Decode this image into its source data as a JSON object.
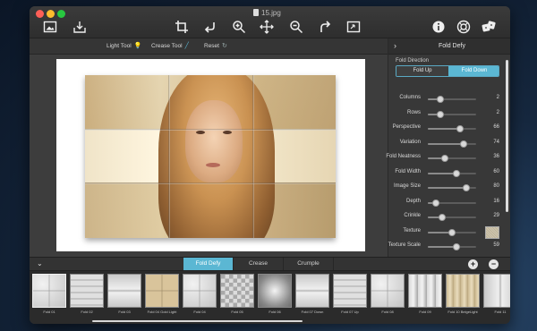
{
  "window": {
    "title": "15.jpg"
  },
  "toolbar": {
    "icons": [
      "image-icon",
      "import-icon",
      "crop-icon",
      "undo-icon",
      "zoom-in-icon",
      "move-icon",
      "zoom-out-icon",
      "redo-icon",
      "fit-screen-icon",
      "info-icon",
      "help-icon",
      "dice-icon"
    ]
  },
  "subbar": {
    "light_tool": "Light Tool",
    "crease_tool": "Crease Tool",
    "reset": "Reset"
  },
  "sidebar": {
    "title": "Fold Defy",
    "fold_direction_label": "Fold Direction",
    "fold_up": "Fold Up",
    "fold_down": "Fold Down",
    "fold_direction_selected": "Fold Down",
    "params": [
      {
        "label": "Columns",
        "value": "2",
        "level": 0.25
      },
      {
        "label": "Rows",
        "value": "2",
        "level": 0.25
      },
      {
        "label": "Perspective",
        "value": "66",
        "level": 0.66
      },
      {
        "label": "Variation",
        "value": "74",
        "level": 0.74
      },
      {
        "label": "Fold Neatness",
        "value": "36",
        "level": 0.36
      },
      {
        "label": "Fold Width",
        "value": "60",
        "level": 0.6
      },
      {
        "label": "Image Size",
        "value": "80",
        "level": 0.8
      },
      {
        "label": "Depth",
        "value": "16",
        "level": 0.16
      },
      {
        "label": "Crinkle",
        "value": "29",
        "level": 0.29
      },
      {
        "label": "Texture",
        "value": "",
        "level": 0.5
      },
      {
        "label": "Texture Scale",
        "value": "59",
        "level": 0.59
      }
    ]
  },
  "bottom": {
    "tabs": [
      "Fold Defy",
      "Crease",
      "Crumple"
    ],
    "active_tab": "Fold Defy",
    "add": "+",
    "remove": "−",
    "presets": [
      {
        "name": "Fold 01",
        "style": "g-grid"
      },
      {
        "name": "Fold 02",
        "style": "g-lines"
      },
      {
        "name": "Fold 03",
        "style": "g-h"
      },
      {
        "name": "Fold 04 Gold Light",
        "style": "g-gold"
      },
      {
        "name": "Fold 04",
        "style": "g-grid"
      },
      {
        "name": "Fold 05",
        "style": "g-checks"
      },
      {
        "name": "Fold 06",
        "style": "g-dark"
      },
      {
        "name": "Fold 07 Down",
        "style": "g-h"
      },
      {
        "name": "Fold 07 Up",
        "style": "g-lines"
      },
      {
        "name": "Fold 08",
        "style": "g-grid"
      },
      {
        "name": "Fold 09",
        "style": "g-stripes"
      },
      {
        "name": "Fold 10 BeigeLight",
        "style": "g-gold2"
      },
      {
        "name": "Fold 11",
        "style": "g-v"
      }
    ]
  },
  "colors": {
    "accent": "#5bb7d3",
    "window_bg": "#3a3a3a"
  }
}
